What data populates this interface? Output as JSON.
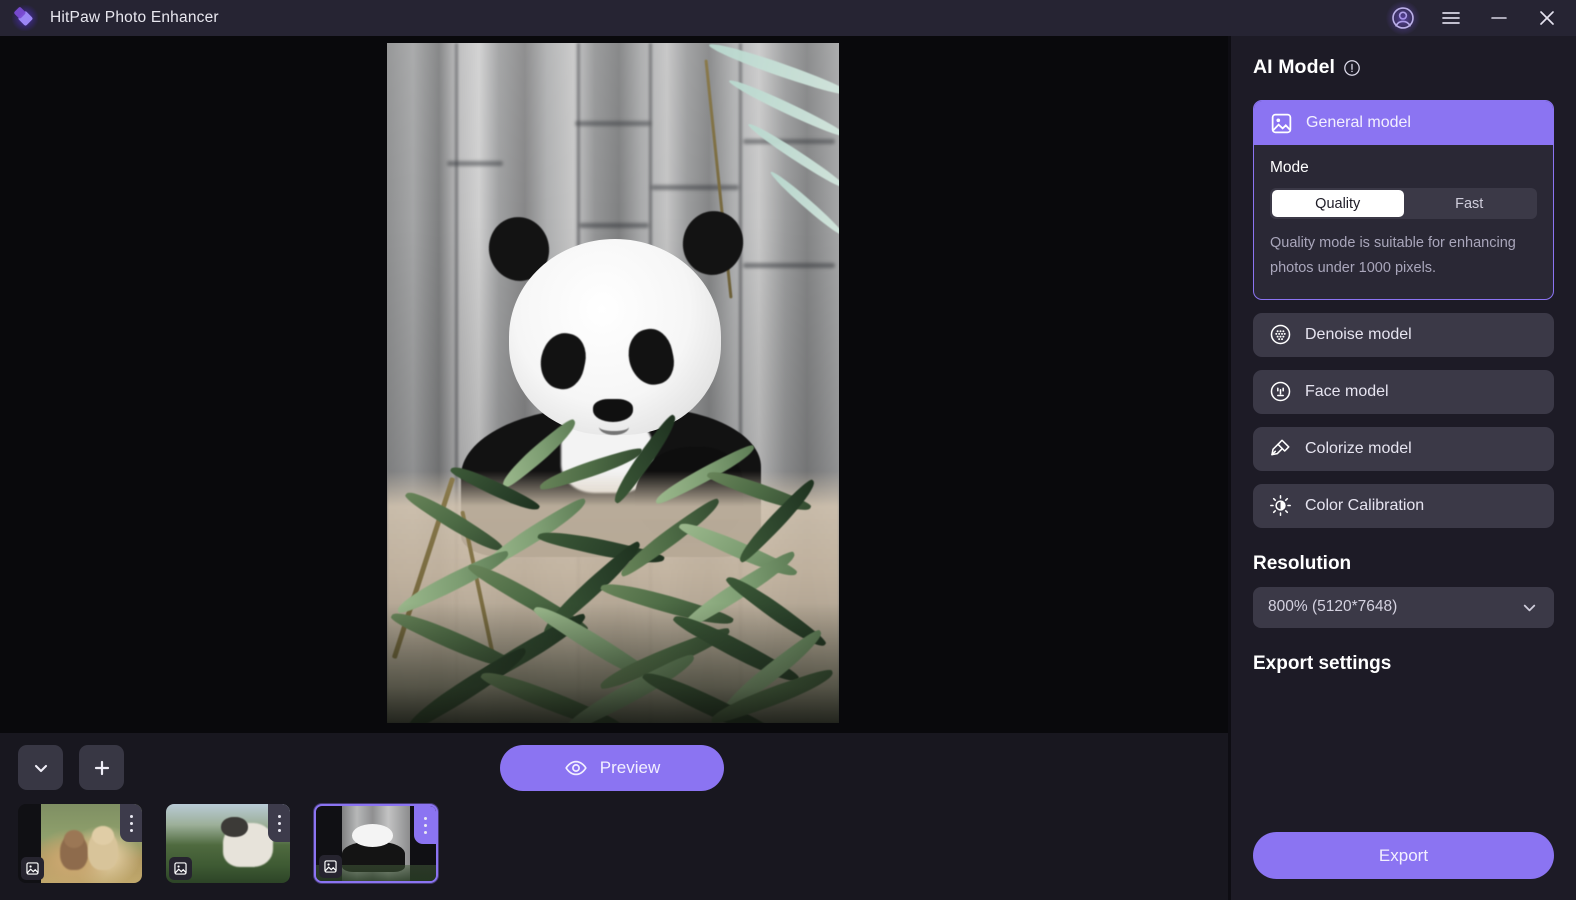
{
  "titlebar": {
    "app_title": "HitPaw Photo Enhancer",
    "logo_icon": "hitpaw-diamond-logo",
    "buttons": [
      {
        "name": "account-button",
        "icon": "account-circle-icon",
        "label": ""
      },
      {
        "name": "menu-button",
        "icon": "hamburger-menu-icon",
        "label": ""
      },
      {
        "name": "minimize-button",
        "icon": "minimize-icon",
        "label": ""
      },
      {
        "name": "close-button",
        "icon": "close-icon",
        "label": ""
      }
    ]
  },
  "canvas": {
    "image_description": "Giant panda sitting among green bamboo leaves in front of grey bamboo trunks",
    "aspect": "portrait"
  },
  "bottombar": {
    "collapse_label": "",
    "collapse_icon": "chevron-down-icon",
    "add_label": "",
    "add_icon": "plus-icon",
    "preview_label": "Preview",
    "preview_icon": "eye-icon",
    "thumbnails": [
      {
        "name": "thumbnail-dogs",
        "caption": "two puppies in grass",
        "selected": false,
        "badge_icon": "image-icon",
        "menu_icon": "more-vertical-icon"
      },
      {
        "name": "thumbnail-cat",
        "caption": "cat in green field",
        "selected": false,
        "badge_icon": "image-icon",
        "menu_icon": "more-vertical-icon"
      },
      {
        "name": "thumbnail-panda",
        "caption": "panda with bamboo",
        "selected": true,
        "badge_icon": "image-icon",
        "menu_icon": "more-vertical-icon"
      }
    ]
  },
  "right_panel": {
    "ai_model_title": "AI Model",
    "ai_model_info_icon": "info-icon",
    "general_model": {
      "label": "General model",
      "icon": "image-icon",
      "selected": true,
      "mode_label": "Mode",
      "modes": [
        {
          "label": "Quality",
          "selected": true
        },
        {
          "label": "Fast",
          "selected": false
        }
      ],
      "description": "Quality mode is suitable for enhancing photos under 1000 pixels."
    },
    "models": [
      {
        "label": "Denoise model",
        "icon": "denoise-dots-circle-icon"
      },
      {
        "label": "Face model",
        "icon": "face-circle-icon"
      },
      {
        "label": "Colorize model",
        "icon": "paint-roller-icon"
      },
      {
        "label": "Color Calibration",
        "icon": "brightness-sun-icon"
      }
    ],
    "resolution_title": "Resolution",
    "resolution_value": "800% (5120*7648)",
    "resolution_chevron_icon": "chevron-down-icon",
    "export_settings_title": "Export settings",
    "export_button_label": "Export"
  },
  "colors": {
    "accent_purple": "#8b74f2",
    "titlebar": "#262433",
    "panel_bg": "#1d1b26",
    "canvas_bg": "#09090c",
    "bottombar_bg": "#18171f",
    "control_bg": "#3b3947",
    "text_primary": "#ffffff",
    "text_secondary": "#a9a6bb"
  }
}
